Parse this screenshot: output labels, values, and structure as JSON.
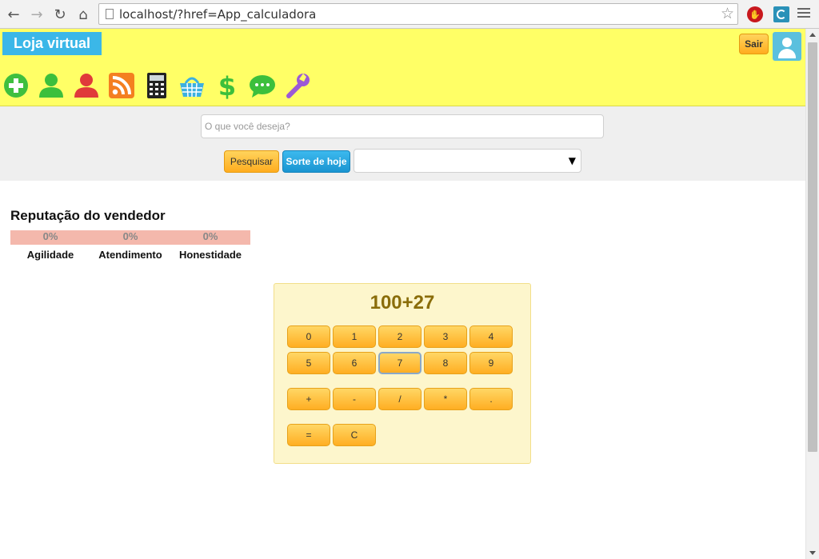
{
  "browser": {
    "url": "localhost/?href=App_calculadora",
    "ext_icon_1": "stop-hand-icon",
    "ext_icon_2": "spiral-icon"
  },
  "header": {
    "brand": "Loja virtual",
    "logout_label": "Sair",
    "toolbar_icons": [
      "add-icon",
      "user-green-icon",
      "user-red-icon",
      "rss-icon",
      "calculator-icon",
      "basket-icon",
      "dollar-icon",
      "chat-icon",
      "wrench-icon"
    ],
    "bg_color": "#ffff66",
    "brand_color": "#3bb7e8"
  },
  "search": {
    "placeholder": "O que você deseja?",
    "value": "",
    "search_label": "Pesquisar",
    "luck_label": "Sorte de hoje",
    "select_value": ""
  },
  "reputation": {
    "title": "Reputação do vendedor",
    "items": [
      {
        "label": "Agilidade",
        "value": "0%"
      },
      {
        "label": "Atendimento",
        "value": "0%"
      },
      {
        "label": "Honestidade",
        "value": "0%"
      }
    ]
  },
  "calculator": {
    "display": "100+27",
    "keys": [
      "0",
      "1",
      "2",
      "3",
      "4",
      "5",
      "6",
      "7",
      "8",
      "9",
      "+",
      "-",
      "/",
      "*",
      ".",
      "=",
      "C"
    ],
    "focused_key": "7"
  }
}
